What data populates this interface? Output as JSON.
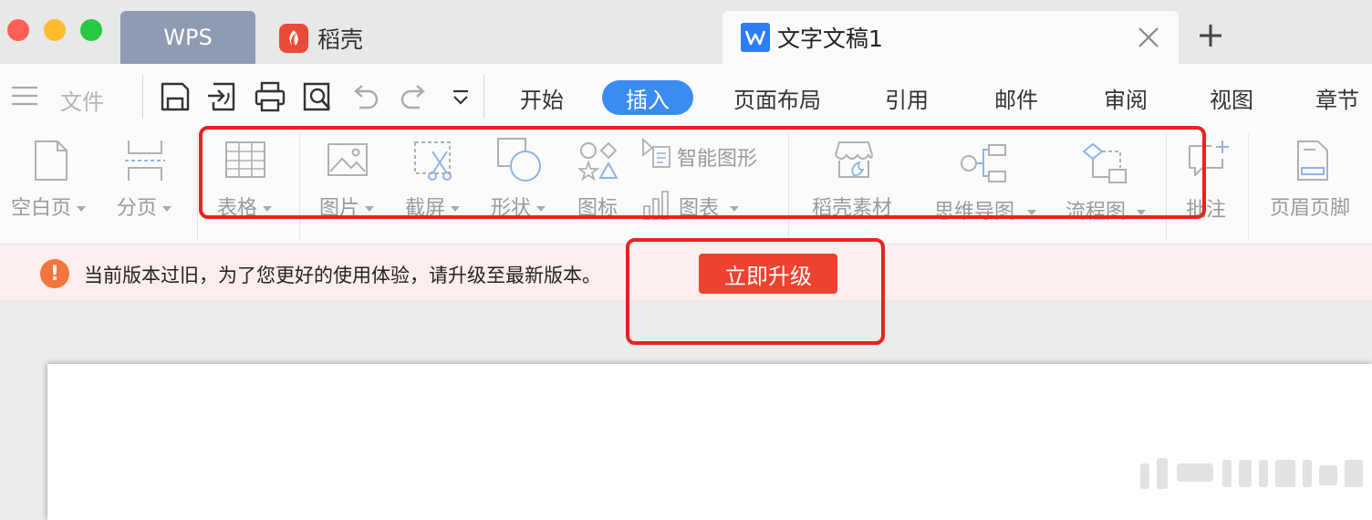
{
  "tabs": {
    "wps": "WPS",
    "daoke": "稻壳",
    "document": "文字文稿1"
  },
  "menu": {
    "file": "文件",
    "tabs": [
      "开始",
      "插入",
      "页面布局",
      "引用",
      "邮件",
      "审阅",
      "视图",
      "章节"
    ],
    "active_tab": "插入"
  },
  "ribbon": {
    "blank_page": "空白页",
    "page_break": "分页",
    "table": "表格",
    "picture": "图片",
    "screenshot": "截屏",
    "shape": "形状",
    "icon": "图标",
    "smart_graphic": "智能图形",
    "chart": "图表",
    "daoke_material": "稻壳素材",
    "mind_map": "思维导图",
    "flowchart": "流程图",
    "comment": "批注",
    "header_footer": "页眉页脚"
  },
  "notification": {
    "message": "当前版本过旧，为了您更好的使用体验，请升级至最新版本。",
    "button": "立即升级"
  },
  "colors": {
    "accent_blue": "#3b8cf0",
    "upgrade_red": "#ef4130",
    "annotation_red": "#e8231c",
    "warning_orange": "#f3753c"
  }
}
